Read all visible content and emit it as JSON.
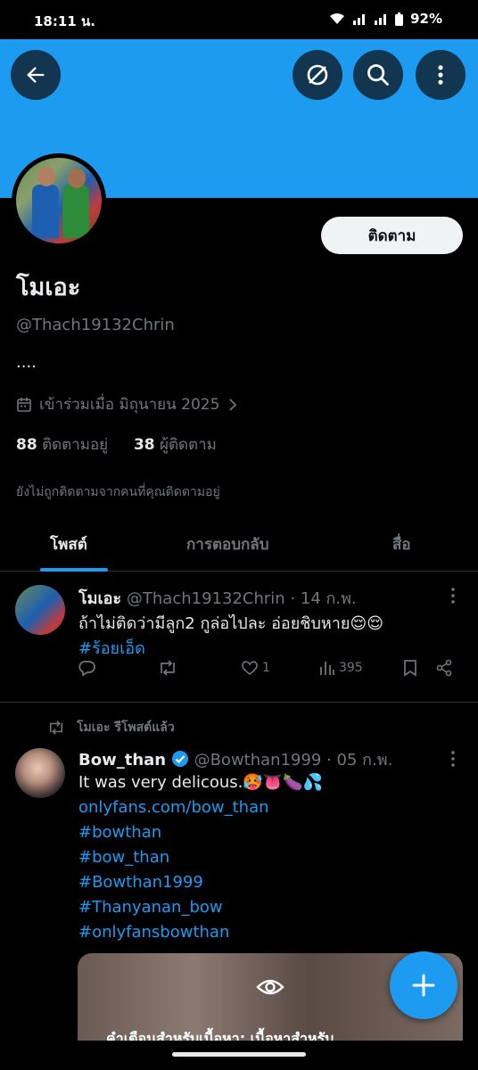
{
  "status_bar": {
    "time": "18:11 น.",
    "battery": "92%"
  },
  "profile": {
    "follow_label": "ติดตาม",
    "name": "โมเอะ",
    "handle": "@Thach19132Chrin",
    "bio": "....",
    "joined": "เข้าร่วมเมื่อ มิถุนายน 2025",
    "following_count": "88",
    "following_label": "ติดตามอยู่",
    "followers_count": "38",
    "followers_label": "ผู้ติดตาม",
    "not_followed_note": "ยังไม่ถูกติดตามจากคนที่คุณติดตามอยู่"
  },
  "tabs": [
    {
      "label": "โพสต์"
    },
    {
      "label": "การตอบกลับ"
    },
    {
      "label": "สื่อ"
    }
  ],
  "posts": [
    {
      "name": "โมเอะ",
      "handle": "@Thach19132Chrin",
      "date": "· 14 ก.พ.",
      "text": "ถ้าไม่ติดว่ามีลูก2 กูล่อไปละ อ่อยชิบหาย😌😌",
      "hashtag": "#ร้อยเอ็ด",
      "likes": "1",
      "views": "395"
    },
    {
      "repost_note": "โมเอะ รีโพสต์แล้ว",
      "name": "Bow_than",
      "handle": "@Bowthan1999",
      "date": "· 05 ก.พ.",
      "text": "It was very delicous.🥵👅🍆💦",
      "lines": [
        "onlyfans.com/bow_than",
        "#bowthan",
        "#bow_than",
        "#Bowthan1999",
        "#Thanyanan_bow",
        "#onlyfansbowthan"
      ],
      "media_warning": "คำเตือนสำหรับเนื้อหา: เนื้อหาสำหรับ"
    }
  ],
  "icons": {
    "back": "back-arrow-icon",
    "grok": "grok-icon",
    "search": "search-icon",
    "more": "more-vertical-icon"
  },
  "colors": {
    "accent": "#1d9bf0",
    "background": "#000000",
    "muted": "#71767b"
  }
}
